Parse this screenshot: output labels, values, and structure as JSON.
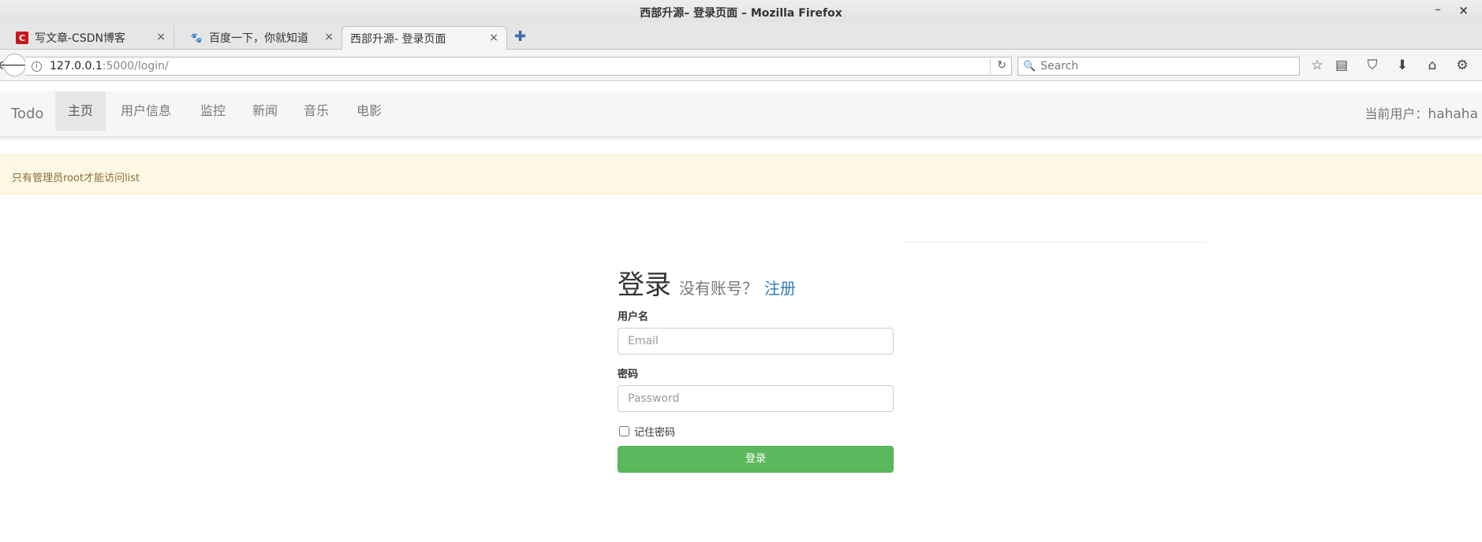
{
  "window": {
    "title": "西部升源– 登录页面 – Mozilla Firefox",
    "minimize_glyph": "–",
    "close_glyph": "×"
  },
  "tabs": [
    {
      "label": "写文章-CSDN博客",
      "icon": "csdn-icon",
      "fav": "C",
      "close": "×"
    },
    {
      "label": "百度一下，你就知道",
      "icon": "baidu-paw-icon",
      "fav": "🐾",
      "close": "×"
    },
    {
      "label": "西部升源- 登录页面",
      "icon": "",
      "fav": "",
      "close": "×"
    }
  ],
  "new_tab_glyph": "✚",
  "toolbar": {
    "back_glyph": "🡐",
    "info_glyph": "i",
    "url_host": "127.0.0.1",
    "url_rest": ":5000/login/",
    "reload_glyph": "↻",
    "search_placeholder": "Search",
    "search_glyph": "🔍",
    "icons": [
      {
        "name": "bookmark-star-icon",
        "glyph": "☆"
      },
      {
        "name": "reader-list-icon",
        "glyph": "▤"
      },
      {
        "name": "pocket-icon",
        "glyph": "⛉"
      },
      {
        "name": "download-icon",
        "glyph": "⬇"
      },
      {
        "name": "home-icon",
        "glyph": "⌂"
      },
      {
        "name": "extension-icon",
        "glyph": "⚙"
      }
    ]
  },
  "app_nav": {
    "brand": "Todo",
    "items": [
      "主页",
      "用户信息",
      "监控",
      "新闻",
      "音乐",
      "电影"
    ],
    "active_index": 0,
    "current_user_label": "当前用户：",
    "current_user": "hahaha"
  },
  "alert": {
    "message": "只有管理员root才能访问list"
  },
  "login": {
    "heading": "登录",
    "no_account": "没有账号？",
    "register_link": "注册",
    "username_label": "用户名",
    "username_placeholder": "Email",
    "password_label": "密码",
    "password_placeholder": "Password",
    "remember_label": "记住密码",
    "remember_checked": false,
    "submit_label": "登录"
  },
  "colors": {
    "alert_bg": "#fcf8e3",
    "alert_text": "#8a6d3b",
    "submit_green": "#5cb85c",
    "link_blue": "#337ab7"
  }
}
